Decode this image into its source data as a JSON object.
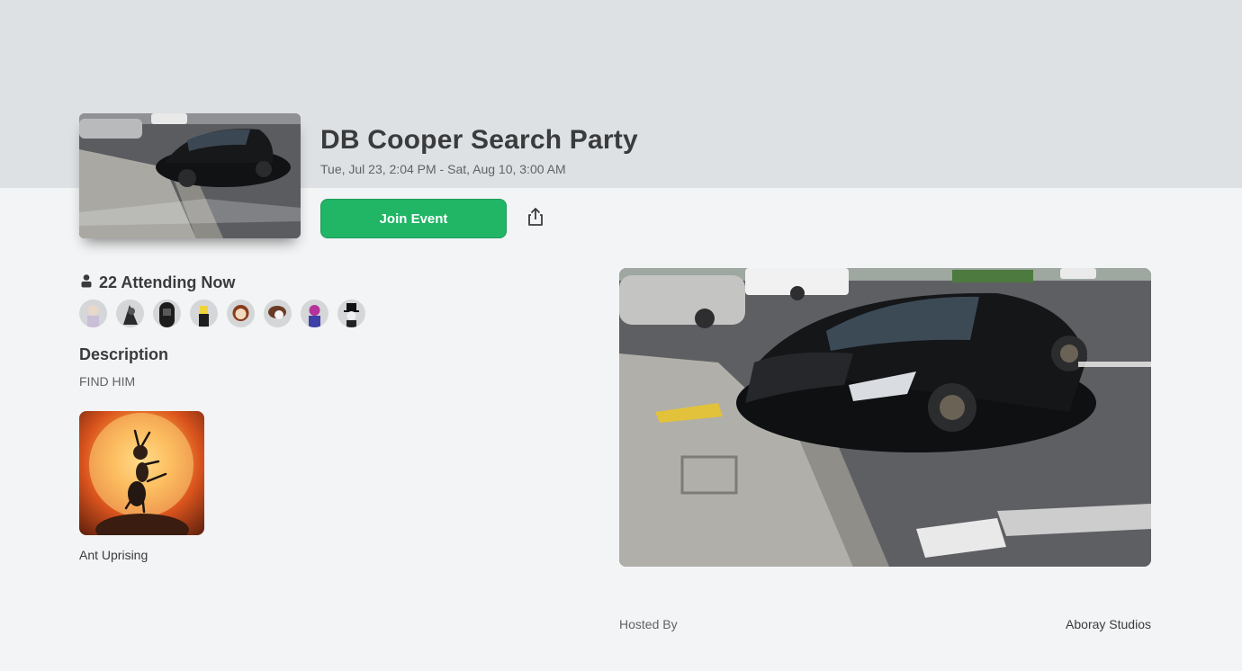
{
  "event": {
    "title": "DB Cooper Search Party",
    "dates": "Tue, Jul 23, 2:04 PM - Sat, Aug 10, 3:00 AM",
    "thumbnail_icon": "car-crash-photo",
    "hero_image_icon": "car-crash-photo"
  },
  "actions": {
    "join_label": "Join Event",
    "join_color": "#21b566",
    "share_icon": "share-icon"
  },
  "attendance": {
    "label": "22 Attending Now",
    "icon": "person-icon",
    "avatars": [
      "avatar-1",
      "avatar-2",
      "avatar-3",
      "avatar-4",
      "avatar-5",
      "avatar-6",
      "avatar-7",
      "avatar-8"
    ]
  },
  "description": {
    "heading": "Description",
    "text": "FIND HIM"
  },
  "game": {
    "name": "Ant Uprising",
    "icon": "ant-game-thumbnail"
  },
  "host": {
    "label": "Hosted By",
    "name": "Aboray Studios"
  }
}
